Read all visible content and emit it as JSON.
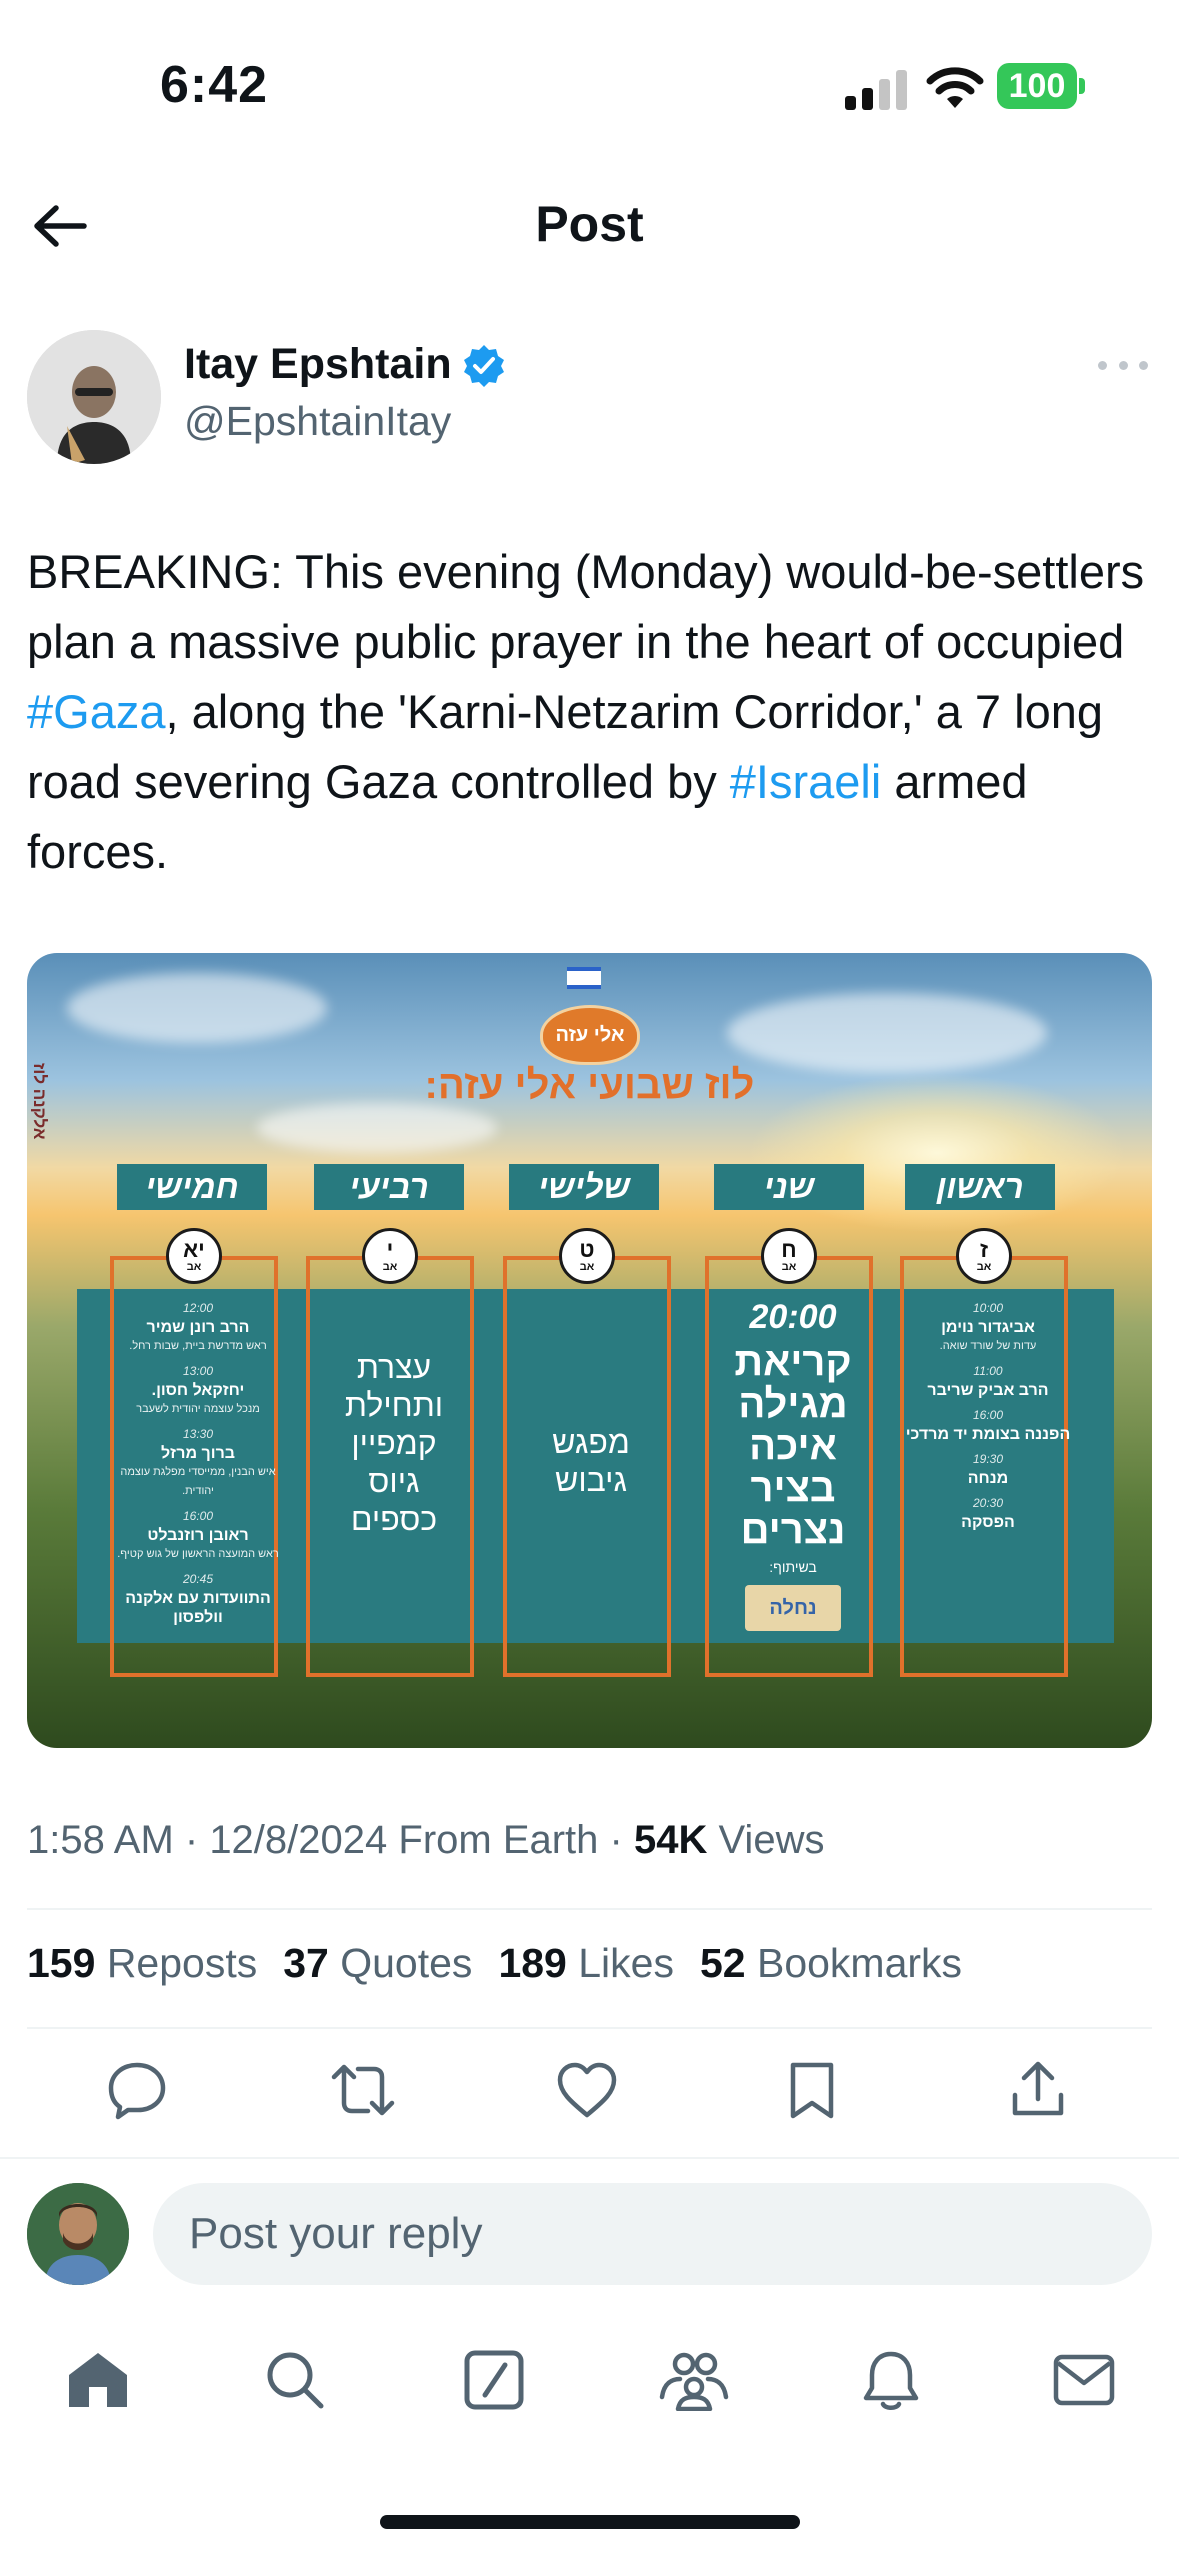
{
  "status_bar": {
    "time": "6:42",
    "battery": "100",
    "battery_color": "#34c759"
  },
  "header": {
    "title": "Post",
    "back_icon": "arrow-left-icon"
  },
  "author": {
    "name": "Itay Epshtain",
    "handle": "@EpshtainItay",
    "verified": true,
    "verified_color": "#1d9bf0"
  },
  "tweet": {
    "text_1": "BREAKING: This evening (Monday) would-be-settlers plan a massive public prayer in the heart of occupied ",
    "hashtag_1": "#Gaza",
    "text_2": ", along the 'Karni-Netzarim Corridor,' a 7 long road severing Gaza controlled by ",
    "hashtag_2": "#Israeli",
    "text_3": " armed forces.",
    "link_color": "#1d9bf0"
  },
  "media": {
    "logo_text": "אלי עזה",
    "title": "לוז שבועי אלי עזה:",
    "side_text": "אלקנה לוז",
    "days": [
      {
        "label": "ראשון",
        "date": "ז",
        "month": "אב"
      },
      {
        "label": "שני",
        "date": "ח",
        "month": "אב"
      },
      {
        "label": "שלישי",
        "date": "ט",
        "month": "אב"
      },
      {
        "label": "רביעי",
        "date": "י",
        "month": "אב"
      },
      {
        "label": "חמישי",
        "date": "יא",
        "month": "אב"
      }
    ],
    "sunday": {
      "items": [
        {
          "time": "10:00",
          "name": "אביגדור נוימן",
          "sub": "עדות של שורד שואה."
        },
        {
          "time": "11:00",
          "name": "הרב אביק שריבר",
          "sub": ""
        },
        {
          "time": "16:00",
          "name": "הפננה בצומת יד מרדכי",
          "sub": ""
        },
        {
          "time": "19:30",
          "name": "מנחה",
          "sub": ""
        },
        {
          "time": "20:30",
          "name": "הפסקה",
          "sub": ""
        }
      ]
    },
    "monday": {
      "time": "20:00",
      "text": "קריאת מגילה איכה בציר נצרים",
      "with_label": "בשיתוף:",
      "partner": "נחלה"
    },
    "tuesday": {
      "text": "מפגש גיבוש"
    },
    "wednesday": {
      "text": "עצרת ותחילת קמפיין גיוס כספים"
    },
    "thursday": {
      "items": [
        {
          "time": "12:00",
          "name": "הרב רונן שמיר",
          "sub": "ראש מדרשת ביית, שבות רחל."
        },
        {
          "time": "13:00",
          "name": "יחזקאל חסון.",
          "sub": "מנכל עוצמה יהודית לשעבר"
        },
        {
          "time": "13:30",
          "name": "ברוך מרזל",
          "sub": "איש הבנין, ממייסדי מפלגת עוצמה יהודית."
        },
        {
          "time": "16:00",
          "name": "ראובן רוזנבלט",
          "sub": "ראש המועצה הראשון של גוש קטיף."
        },
        {
          "time": "20:45",
          "name": "התוועדות עם אלקנה וולפסון",
          "sub": ""
        }
      ]
    },
    "colors": {
      "teal": "#2a7b80",
      "orange": "#e0712b"
    }
  },
  "meta": {
    "time": "1:58 AM",
    "sep1": " · ",
    "date": "12/8/2024",
    "source": " From Earth",
    "sep2": " · ",
    "views_count": "54K",
    "views_label": " Views"
  },
  "stats": {
    "reposts_count": "159",
    "reposts_label": " Reposts",
    "quotes_count": "37",
    "quotes_label": " Quotes",
    "likes_count": "189",
    "likes_label": " Likes",
    "bookmarks_count": "52",
    "bookmarks_label": " Bookmarks"
  },
  "actions": [
    "reply-icon",
    "repost-icon",
    "like-icon",
    "bookmark-icon",
    "share-icon"
  ],
  "reply": {
    "placeholder": "Post your reply"
  },
  "tabbar": [
    "home-icon",
    "search-icon",
    "grok-icon",
    "communities-icon",
    "notifications-icon",
    "messages-icon"
  ]
}
